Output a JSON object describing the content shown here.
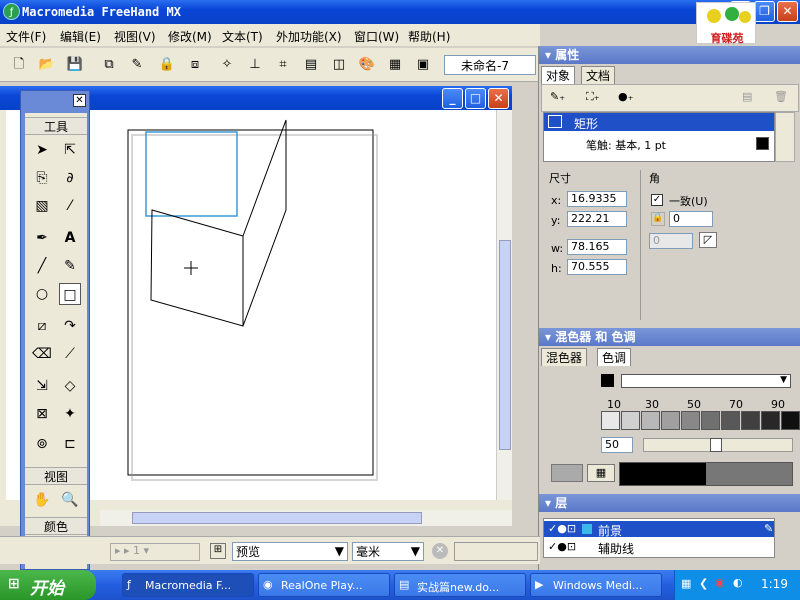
{
  "window": {
    "title": "Macromedia FreeHand MX",
    "logo_text": "育碟苑"
  },
  "menu": [
    "文件(F)",
    "编辑(E)",
    "视图(V)",
    "修改(M)",
    "文本(T)",
    "外加功能(X)",
    "窗口(W)",
    "帮助(H)"
  ],
  "toolbar": {
    "doc_name": "未命名-7"
  },
  "tools": {
    "title": "工具",
    "view_label": "视图",
    "color_label": "颜色"
  },
  "properties": {
    "title": "属性",
    "tabs": [
      "对象",
      "文档"
    ],
    "object_name": "矩形",
    "stroke": "笔触: 基本, 1 pt",
    "size_label": "尺寸",
    "corner_label": "角",
    "x_label": "x:",
    "y_label": "y:",
    "w_label": "w:",
    "h_label": "h:",
    "x": "16.9335",
    "y": "222.21",
    "w": "78.165",
    "h": "70.555",
    "uniform_label": "一致(U)",
    "corner1": "0",
    "corner2": "0"
  },
  "mixer": {
    "title": "混色器 和 色调",
    "tabs": [
      "混色器",
      "色调"
    ],
    "ticks": [
      "10",
      "30",
      "50",
      "70",
      "90"
    ],
    "value": "50",
    "swatches": [
      "#e8e8e8",
      "#d0d0d0",
      "#b8b8b8",
      "#a0a0a0",
      "#888888",
      "#707070",
      "#585858",
      "#404040",
      "#282828",
      "#101010"
    ]
  },
  "layers": {
    "title": "层",
    "items": [
      "前景",
      "辅助线"
    ]
  },
  "status": {
    "view_mode": "预览",
    "unit": "毫米"
  },
  "taskbar": {
    "start": "开始",
    "items": [
      "Macromedia F...",
      "RealOne Play...",
      "实战篇new.do...",
      "Windows Medi..."
    ],
    "clock": "1:19"
  }
}
